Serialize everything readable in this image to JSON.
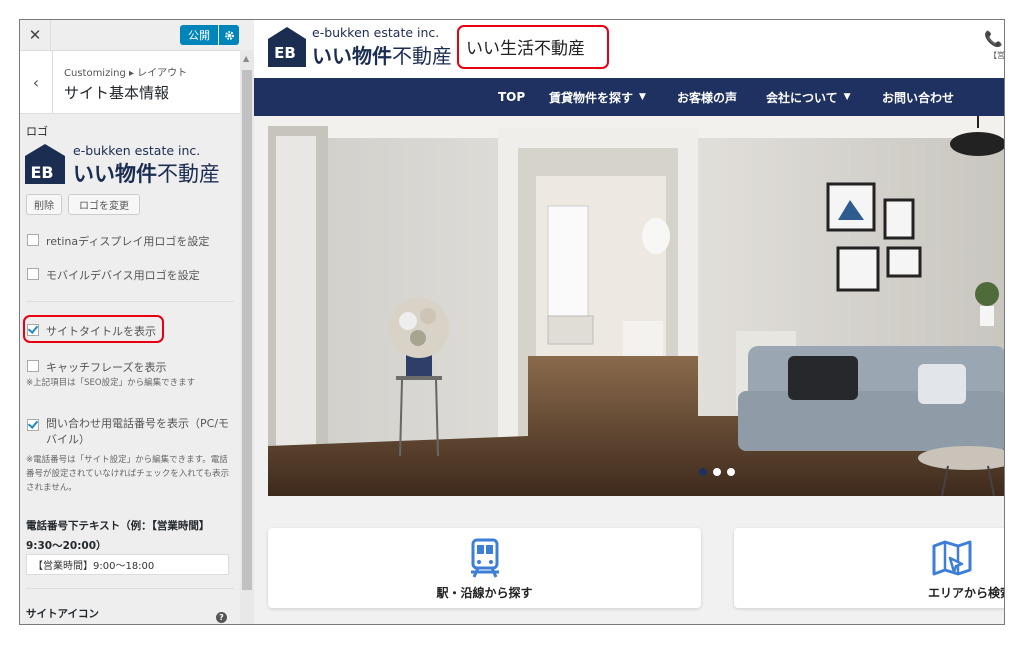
{
  "sidebar": {
    "close_symbol": "✕",
    "publish_label": "公開",
    "back_symbol": "‹",
    "breadcrumb": "Customizing ▸ レイアウト",
    "section_title": "サイト基本情報",
    "logo_label": "ロゴ",
    "logo": {
      "badge": "EB",
      "sub": "e-bukken estate inc.",
      "main_bold": "いい物件",
      "main_rest": "不動産"
    },
    "delete_label": "削除",
    "change_logo_label": "ロゴを変更",
    "options": [
      {
        "label": "retinaディスプレイ用ロゴを設定",
        "checked": false
      },
      {
        "label": "モバイルデバイス用ロゴを設定",
        "checked": false
      },
      {
        "label": "サイトタイトルを表示",
        "checked": true
      },
      {
        "label": "キャッチフレーズを表示",
        "checked": false
      },
      {
        "label": "問い合わせ用電話番号を表示（PC/モバイル）",
        "checked": true
      }
    ],
    "note_seo": "※上記項目は「SEO設定」から編集できます",
    "note_tel": "※電話番号は「サイト設定」から編集できます。電話番号が設定されていなければチェックを入れても表示されません。",
    "tel_text_label": "電話番号下テキスト（例：【営業時間】9:30〜20:00）",
    "tel_text_value": "【営業時間】9:00〜18:00",
    "site_icon_label": "サイトアイコン"
  },
  "preview": {
    "logo": {
      "badge": "EB",
      "sub": "e-bukken estate inc.",
      "main_bold": "いい物件",
      "main_rest": "不動産"
    },
    "site_title": "いい生活不動産",
    "phone_sub": "【営",
    "nav": [
      {
        "label": "TOP",
        "dropdown": false
      },
      {
        "label": "賃貸物件を探す",
        "dropdown": true
      },
      {
        "label": "お客様の声",
        "dropdown": false
      },
      {
        "label": "会社について",
        "dropdown": true
      },
      {
        "label": "お問い合わせ",
        "dropdown": false
      }
    ],
    "cards": [
      {
        "label": "駅・沿線から探す",
        "icon": "train-icon"
      },
      {
        "label": "エリアから検索",
        "icon": "map-icon"
      }
    ]
  },
  "colors": {
    "nav_bg": "#1e3161",
    "logo_navy": "#1c2d52",
    "wp_blue": "#0085ba",
    "highlight_red": "#e60012"
  }
}
